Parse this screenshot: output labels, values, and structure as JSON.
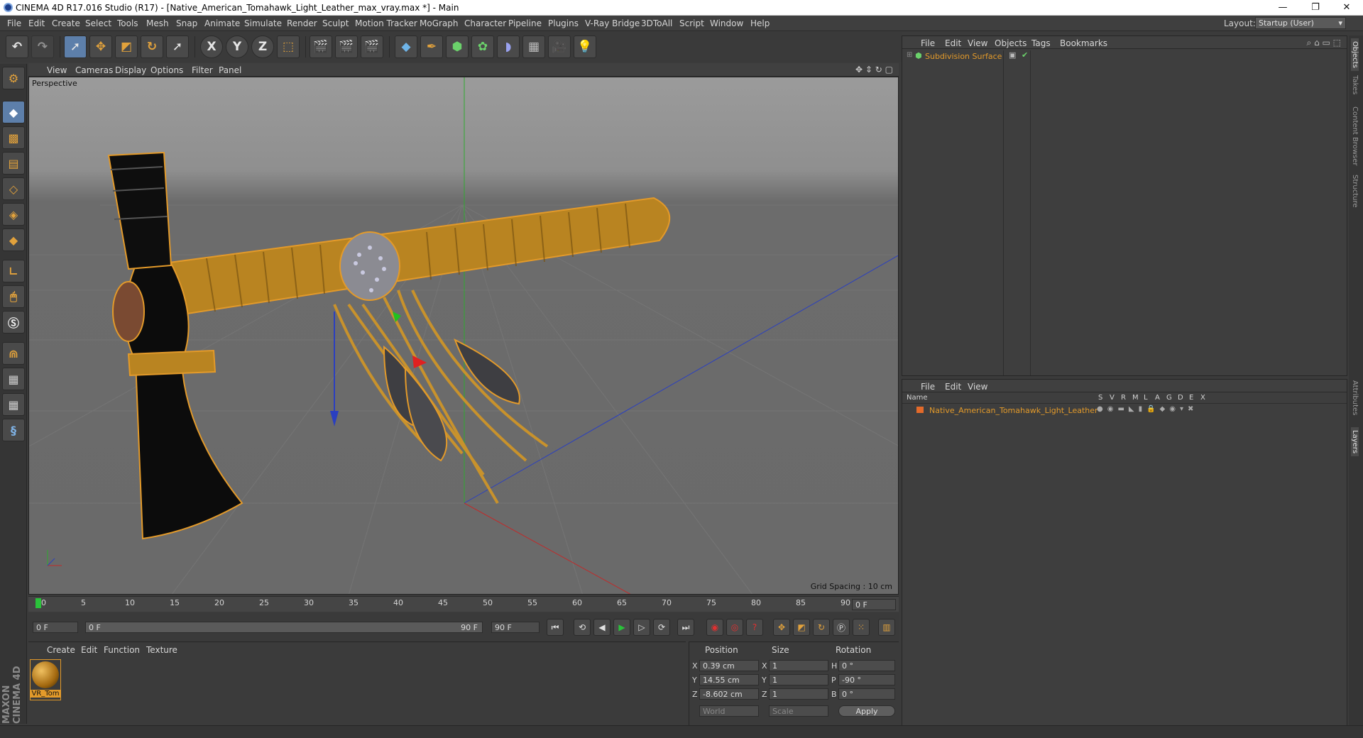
{
  "window": {
    "title": "CINEMA 4D R17.016 Studio (R17) - [Native_American_Tomahawk_Light_Leather_max_vray.max *] - Main",
    "minimize": "—",
    "restore": "❐",
    "close": "✕"
  },
  "menubar": {
    "items": [
      "File",
      "Edit",
      "Create",
      "Select",
      "Tools",
      "Mesh",
      "Snap",
      "Animate",
      "Simulate",
      "Render",
      "Sculpt",
      "Motion Tracker",
      "MoGraph",
      "Character",
      "Pipeline",
      "Plugins",
      "V-Ray Bridge",
      "3DToAll",
      "Script",
      "Window",
      "Help"
    ],
    "layout_label": "Layout:",
    "layout_value": "Startup (User)"
  },
  "toolbar": {
    "axis_x": "X",
    "axis_y": "Y",
    "axis_z": "Z"
  },
  "viewport": {
    "menu": [
      "View",
      "Cameras",
      "Display",
      "Options",
      "Filter",
      "Panel"
    ],
    "label": "Perspective",
    "grid_spacing": "Grid Spacing : 10 cm"
  },
  "timeline": {
    "ticks": [
      "0",
      "5",
      "10",
      "15",
      "20",
      "25",
      "30",
      "35",
      "40",
      "45",
      "50",
      "55",
      "60",
      "65",
      "70",
      "75",
      "80",
      "85",
      "90"
    ],
    "current_frame": "0 F"
  },
  "transport": {
    "start_field": "0 F",
    "range_start": "0 F",
    "range_end": "90 F",
    "end_field": "90 F"
  },
  "material_panel": {
    "menu": [
      "Create",
      "Edit",
      "Function",
      "Texture"
    ],
    "material_name": "VR_Tom"
  },
  "coordinates": {
    "headers": [
      "Position",
      "Size",
      "Rotation"
    ],
    "rows": [
      {
        "axis": "X",
        "pos": "0.39 cm",
        "size_axis": "X",
        "size": "1",
        "rot_axis": "H",
        "rot": "0 °"
      },
      {
        "axis": "Y",
        "pos": "14.55 cm",
        "size_axis": "Y",
        "size": "1",
        "rot_axis": "P",
        "rot": "-90 °"
      },
      {
        "axis": "Z",
        "pos": "-8.602 cm",
        "size_axis": "Z",
        "size": "1",
        "rot_axis": "B",
        "rot": "0 °"
      }
    ],
    "world_select": "World",
    "scale_select": "Scale",
    "apply": "Apply"
  },
  "object_manager": {
    "menu": [
      "File",
      "Edit",
      "View",
      "Objects",
      "Tags",
      "Bookmarks"
    ],
    "object_name": "Subdivision Surface"
  },
  "layer_manager": {
    "menu": [
      "File",
      "Edit",
      "View"
    ],
    "columns": [
      "Name",
      "S",
      "V",
      "R",
      "M",
      "L",
      "A",
      "G",
      "D",
      "E",
      "X"
    ],
    "layer_name": "Native_American_Tomahawk_Light_Leather"
  },
  "right_tabs": [
    "Objects",
    "Takes",
    "Content Browser",
    "Structure",
    "Attributes",
    "Layers"
  ],
  "branding": "MAXON CINEMA 4D",
  "colors": {
    "accent_orange": "#e39a2a",
    "leather": "#b8801a",
    "layer_color": "#e36a2a"
  }
}
